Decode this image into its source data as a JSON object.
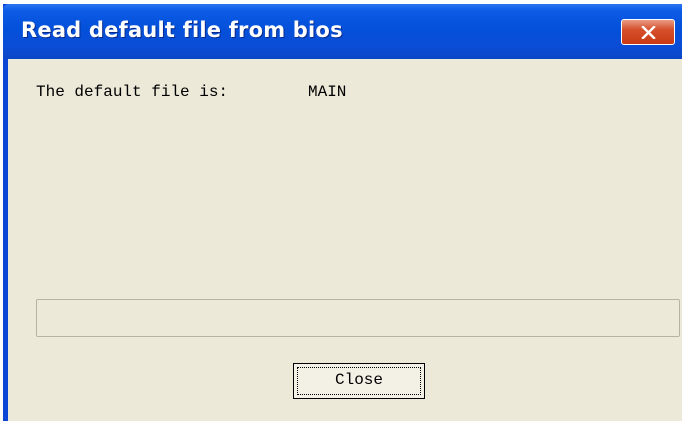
{
  "window": {
    "title": "Read default file from bios",
    "close_icon": "close-x-icon"
  },
  "content": {
    "label": "The default file is:",
    "value": "MAIN"
  },
  "progress": {
    "fraction": 0.0
  },
  "buttons": {
    "close_label": "Close"
  },
  "colors": {
    "titlebar": "#0a4dd6",
    "client_background": "#ece9d8",
    "close_button_red": "#c93a12"
  }
}
